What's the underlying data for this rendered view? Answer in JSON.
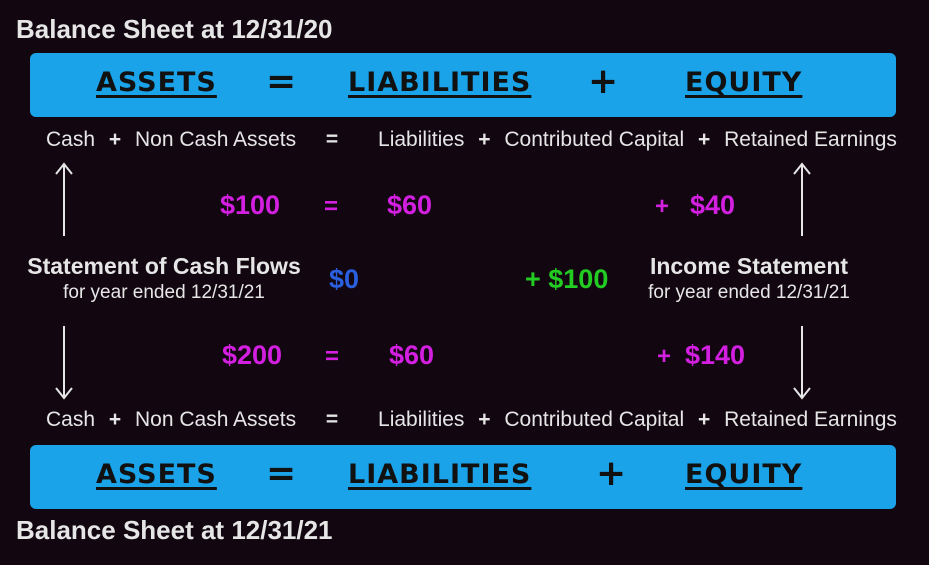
{
  "top": {
    "heading": "Balance Sheet at 12/31/20",
    "bar": {
      "assets": "ASSETS",
      "eq": "=",
      "liabilities": "LIABILITIES",
      "plus": "+",
      "equity": "EQUITY"
    },
    "row": {
      "cash": "Cash",
      "plus1": "+",
      "noncash": "Non Cash Assets",
      "eq": "=",
      "liabilities": "Liabilities",
      "plus2": "+",
      "contributed": "Contributed Capital",
      "plus3": "+",
      "retained": "Retained Earnings"
    },
    "values": {
      "assets": "$100",
      "eq": "=",
      "liabilities": "$60",
      "plus": "+",
      "equity": "$40"
    }
  },
  "middle": {
    "cash_flows": {
      "title": "Statement of Cash Flows",
      "subtitle": "for year ended 12/31/21",
      "change": "$0"
    },
    "income": {
      "title": "Income Statement",
      "subtitle": "for year ended 12/31/21",
      "change": "+ $100"
    }
  },
  "bottom": {
    "values": {
      "assets": "$200",
      "eq": "=",
      "liabilities": "$60",
      "plus": "+",
      "equity": "$140"
    },
    "row": {
      "cash": "Cash",
      "plus1": "+",
      "noncash": "Non Cash Assets",
      "eq": "=",
      "liabilities": "Liabilities",
      "plus2": "+",
      "contributed": "Contributed Capital",
      "plus3": "+",
      "retained": "Retained Earnings"
    },
    "bar": {
      "assets": "ASSETS",
      "eq": "=",
      "liabilities": "LIABILITIES",
      "plus": "+",
      "equity": "EQUITY"
    },
    "heading": "Balance Sheet at 12/31/21"
  },
  "colors": {
    "background": "#120610",
    "bar": "#1aa3e8",
    "balance_values": "#d21fe0",
    "cash_change": "#2a5fe0",
    "income_change": "#22cc22"
  }
}
